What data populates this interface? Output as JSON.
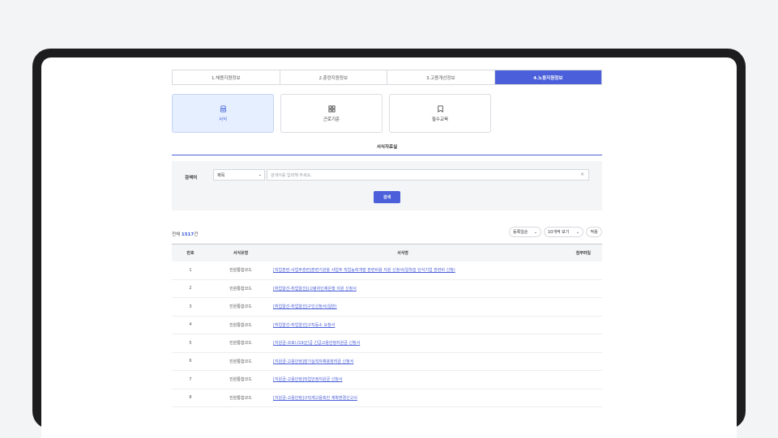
{
  "tabs": [
    {
      "label": "1.채용지원정보",
      "active": false
    },
    {
      "label": "2.훈련지원정보",
      "active": false
    },
    {
      "label": "3.고용개선정보",
      "active": false
    },
    {
      "label": "4.노동지원정보",
      "active": true
    }
  ],
  "cards": [
    {
      "label": "서식",
      "icon": "document-stack-icon",
      "active": true
    },
    {
      "label": "근로기준",
      "icon": "grid-icon",
      "active": false
    },
    {
      "label": "필수교육",
      "icon": "book-icon",
      "active": false
    }
  ],
  "section_title": "서식자료실",
  "search": {
    "label": "검색어",
    "field_select": "제목",
    "placeholder": "검색어를 입력해 주세요.",
    "clear": "×",
    "button": "검색"
  },
  "list": {
    "total_prefix": "전체 ",
    "total_count": "1517",
    "total_suffix": "건",
    "sort": "등록일순",
    "page_size": "10개씩 보기",
    "apply": "적용"
  },
  "table": {
    "headers": {
      "no": "번호",
      "type": "서식유형",
      "title": "서식명",
      "file": "첨부파일"
    },
    "rows": [
      {
        "no": "1",
        "type": "민원통합코드",
        "title": "[직업훈련-사업주훈련]훈련기관을 사업주 직업능력개발 훈련비용 지원 신청서(일학습 단식기업 훈련비 신청)"
      },
      {
        "no": "2",
        "type": "민원통합코드",
        "title": "[취업알선-취업알선](고령자인재은행 지원 신청서"
      },
      {
        "no": "3",
        "type": "민원통합코드",
        "title": "[취업알선-취업알선]구인신청서(일반)"
      },
      {
        "no": "4",
        "type": "민원통합코드",
        "title": "[취업알선-취업알선]구직등소 요청서"
      },
      {
        "no": "5",
        "type": "민원통합코드",
        "title": "[지원금-코로나19]긴급 긴급고용안정지원금 신청서"
      },
      {
        "no": "6",
        "type": "민원통합코드",
        "title": "[지원금-고용안정]장기실직자채용장려금 신청서"
      },
      {
        "no": "7",
        "type": "민원통합코드",
        "title": "[지원금-고용안정]직업안정지원금 신청서"
      },
      {
        "no": "8",
        "type": "민원통합코드",
        "title": "[지원금-고용안정]구직계고용촉진 계획변경신고서"
      }
    ]
  },
  "colors": {
    "accent": "#4a5fd9",
    "active_card_bg": "#e6efff"
  }
}
